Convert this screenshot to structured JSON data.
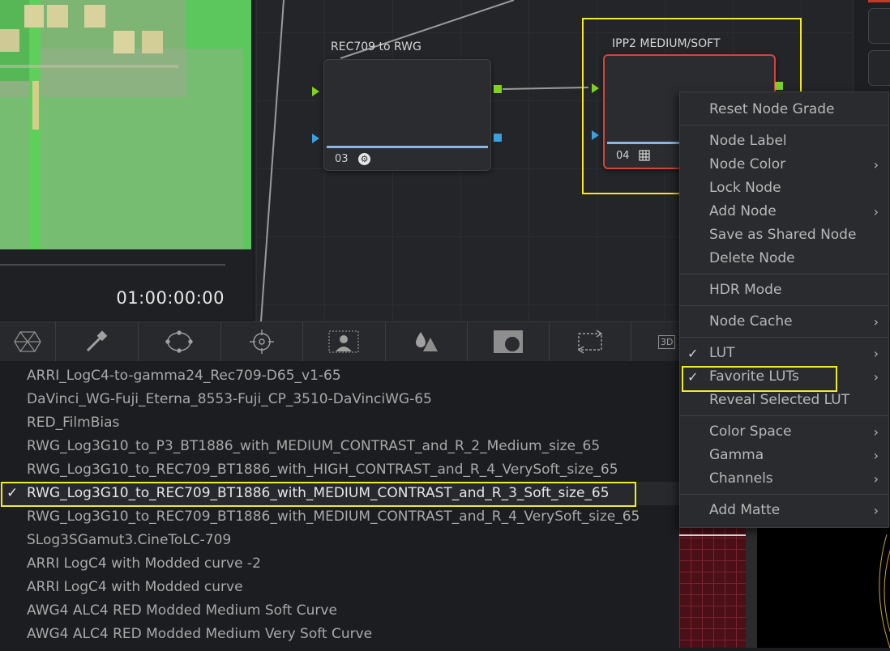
{
  "viewer": {
    "timecode": "01:00:00:00"
  },
  "nodes": [
    {
      "title": "REC709 to RWG",
      "number": "03",
      "icon": "fx-icon"
    },
    {
      "title": "IPP2 MEDIUM/SOFT",
      "number": "04",
      "icon": "lut-grid-icon"
    }
  ],
  "toolbar": {
    "tools": [
      "color-wheels-icon",
      "qualifier-eyedropper-icon",
      "window-circle-icon",
      "tracker-icon",
      "magic-mask-icon",
      "blur-icon",
      "key-icon",
      "sizing-icon",
      "3d-icon"
    ],
    "partial_label": "3D"
  },
  "lut_list": {
    "check": "✓",
    "items": [
      "ARRI_LogC4-to-gamma24_Rec709-D65_v1-65",
      "DaVinci_WG-Fuji_Eterna_8553-Fuji_CP_3510-DaVinciWG-65",
      "RED_FilmBias",
      "RWG_Log3G10_to_P3_BT1886_with_MEDIUM_CONTRAST_and_R_2_Medium_size_65",
      "RWG_Log3G10_to_REC709_BT1886_with_HIGH_CONTRAST_and_R_4_VerySoft_size_65",
      "RWG_Log3G10_to_REC709_BT1886_with_MEDIUM_CONTRAST_and_R_3_Soft_size_65",
      "RWG_Log3G10_to_REC709_BT1886_with_MEDIUM_CONTRAST_and_R_4_VerySoft_size_65",
      "SLog3SGamut3.CineToLC-709",
      "ARRI LogC4 with Modded curve -2",
      "ARRI LogC4 with Modded curve",
      "AWG4 ALC4 RED Modded Medium Soft Curve",
      "AWG4 ALC4 RED Modded Medium Very Soft Curve"
    ],
    "selected_index": 5
  },
  "context_menu": {
    "check": "✓",
    "chevron": "›",
    "items": [
      {
        "label": "Reset Node Grade"
      },
      {
        "label": "Node Label"
      },
      {
        "label": "Node Color",
        "submenu": true
      },
      {
        "label": "Lock Node"
      },
      {
        "label": "Add Node",
        "submenu": true
      },
      {
        "label": "Save as Shared Node"
      },
      {
        "label": "Delete Node"
      },
      {
        "label": "HDR Mode"
      },
      {
        "label": "Node Cache",
        "submenu": true
      },
      {
        "label": "LUT",
        "submenu": true,
        "checked": true
      },
      {
        "label": "Favorite LUTs",
        "submenu": true,
        "checked": true
      },
      {
        "label": "Reveal Selected LUT"
      },
      {
        "label": "Color Space",
        "submenu": true
      },
      {
        "label": "Gamma",
        "submenu": true
      },
      {
        "label": "Channels",
        "submenu": true
      },
      {
        "label": "Add Matte",
        "submenu": true
      }
    ]
  },
  "colors": {
    "highlight_box": "#f2ea25",
    "port_green": "#7ed321",
    "port_blue": "#3aa0e0",
    "selected_node_border": "#d0463a"
  }
}
